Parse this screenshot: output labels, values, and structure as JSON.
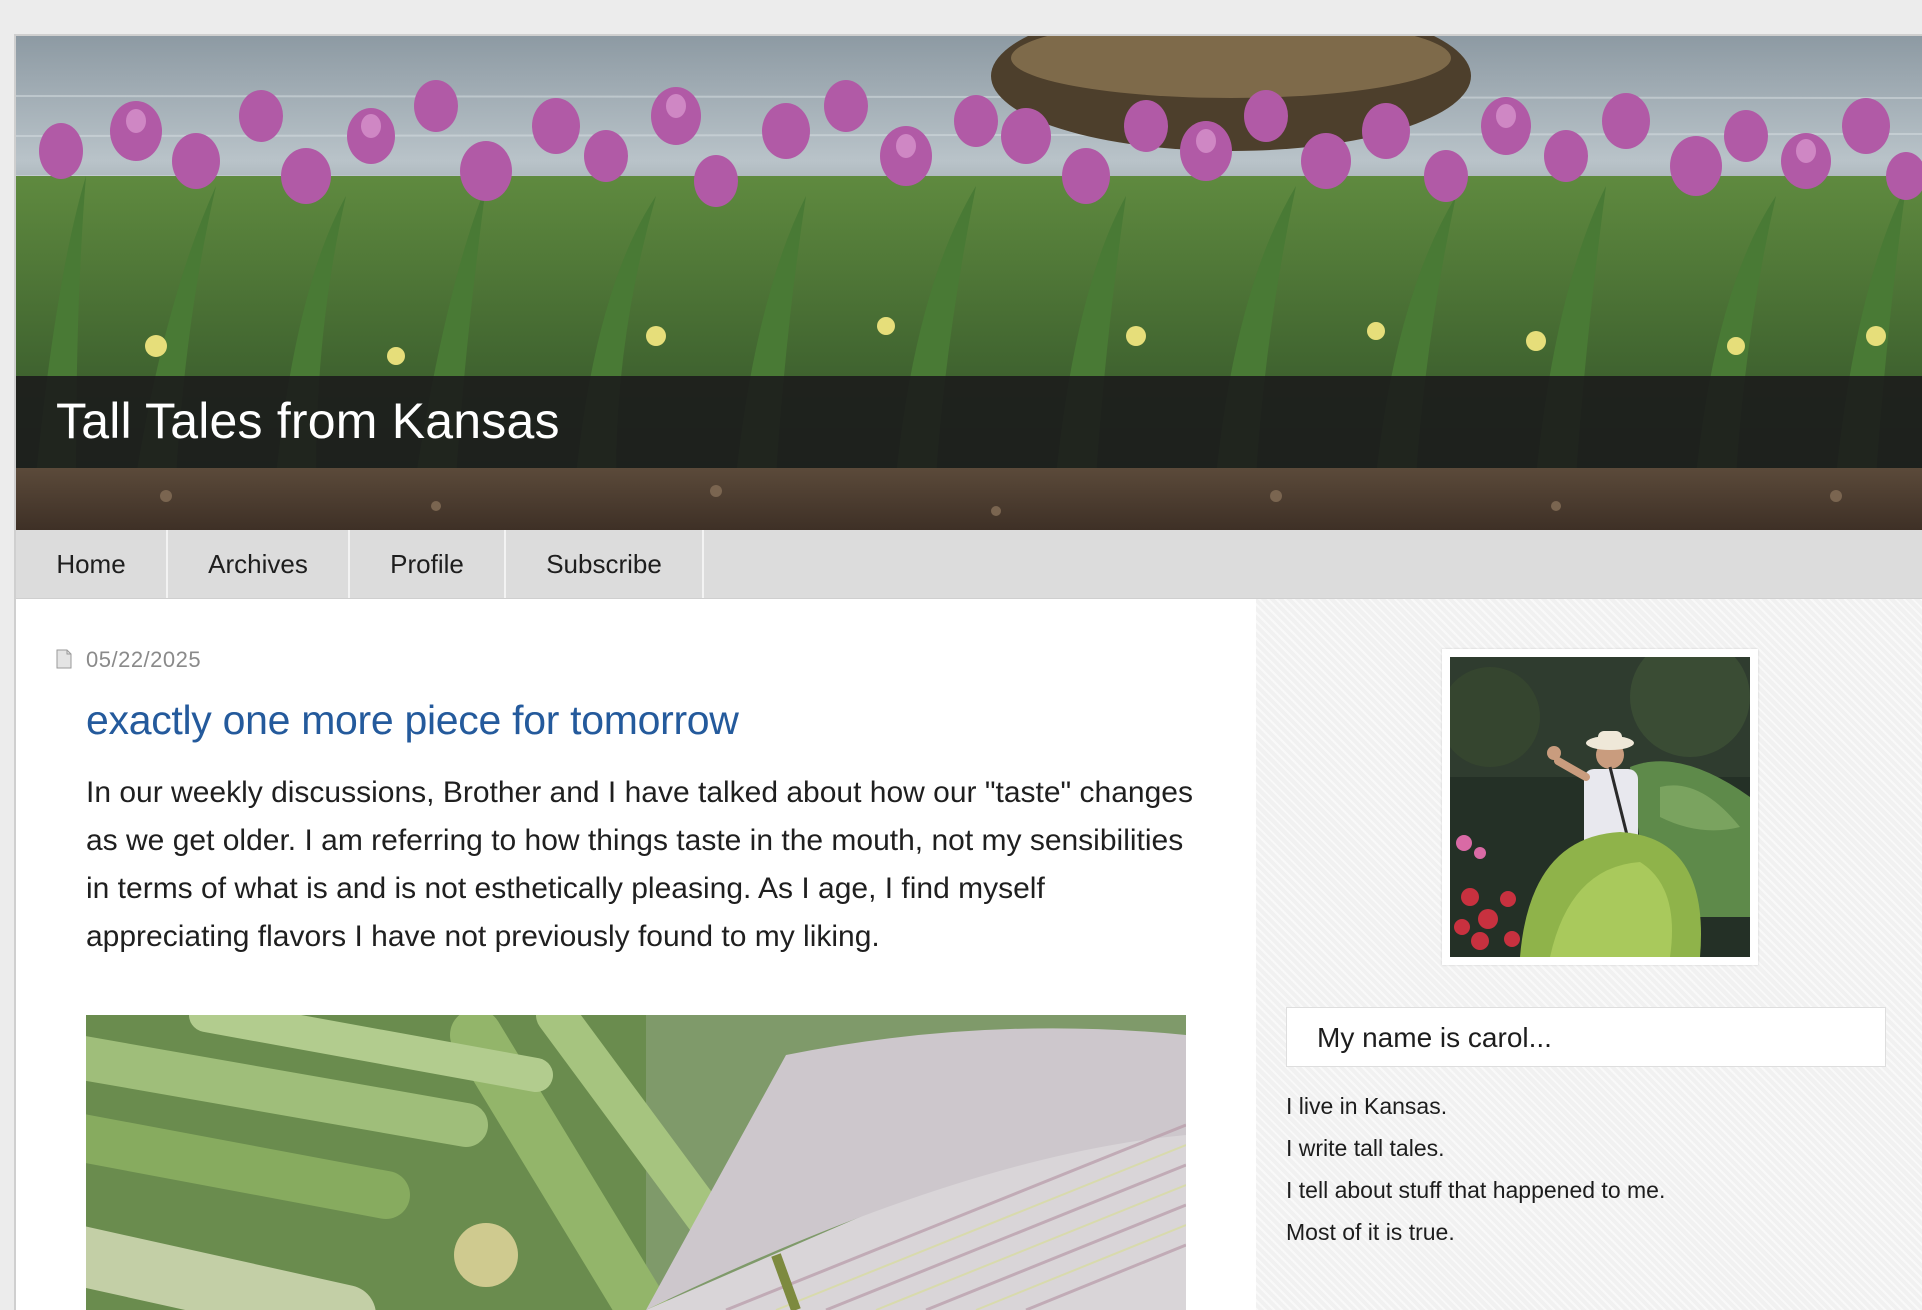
{
  "blog": {
    "title": "Tall Tales from Kansas"
  },
  "nav": {
    "items": [
      {
        "label": "Home"
      },
      {
        "label": "Archives"
      },
      {
        "label": "Profile"
      },
      {
        "label": "Subscribe"
      }
    ]
  },
  "post": {
    "date": "05/22/2025",
    "title": "exactly one more piece for tomorrow",
    "body": "In our weekly discussions, Brother and I have talked about how our \"taste\" changes as we get older. I am referring to how things taste in the mouth, not my sensibilities in terms of what is and is not esthetically pleasing. As I age, I find myself appreciating flavors I have not previously found to my liking."
  },
  "sidebar": {
    "about_title": "My name is carol...",
    "about_lines": [
      "I live in Kansas.",
      "I write tall tales.",
      "I tell about stuff that happened to me.",
      "Most of it is true."
    ]
  },
  "colors": {
    "post_title": "#245a9c",
    "title_bar": "#1c1c1c",
    "nav_bg": "#dcdcdc",
    "tulip": "#b15aa6"
  }
}
